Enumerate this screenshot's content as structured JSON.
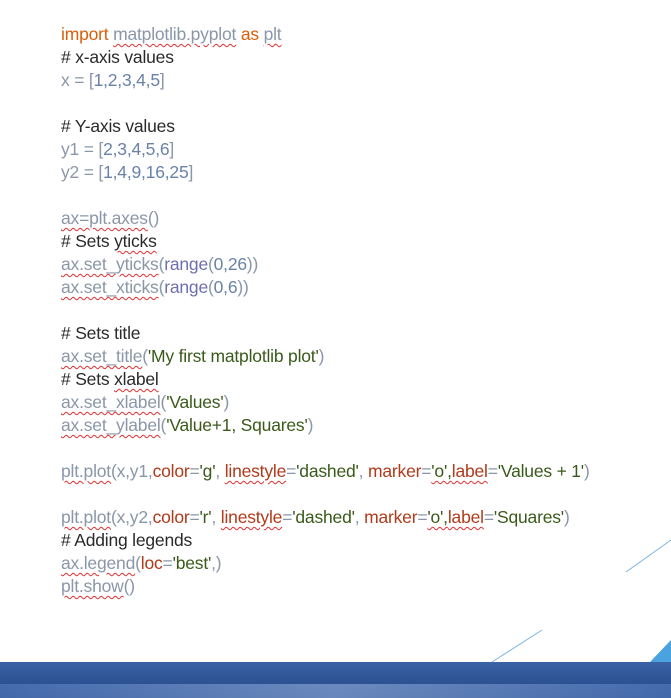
{
  "colors": {
    "keyword": "#d9600a",
    "module": "#8a97a8",
    "comment": "#2a2a2a",
    "plain": "#8a97a8",
    "number": "#6a82a8",
    "builtin": "#6f6fb0",
    "param": "#b03a1a",
    "string": "#3a5a1a"
  },
  "code_lines": [
    [
      {
        "t": "import",
        "c": "keyword"
      },
      {
        "t": " ",
        "c": "plain"
      },
      {
        "t": "matplotlib.pyplot",
        "c": "module",
        "sq": true
      },
      {
        "t": " as ",
        "c": "keyword"
      },
      {
        "t": "plt",
        "c": "module",
        "sq": true
      }
    ],
    [
      {
        "t": "# x-axis values",
        "c": "comment"
      }
    ],
    [
      {
        "t": "x = [",
        "c": "plain"
      },
      {
        "t": "1,2,3,4,5",
        "c": "number"
      },
      {
        "t": "]",
        "c": "plain"
      }
    ],
    [],
    [
      {
        "t": "# Y-axis values",
        "c": "comment"
      }
    ],
    [
      {
        "t": "y1 = [",
        "c": "plain"
      },
      {
        "t": "2,3,4,5,6",
        "c": "number"
      },
      {
        "t": "]",
        "c": "plain"
      }
    ],
    [
      {
        "t": "y2 = [",
        "c": "plain"
      },
      {
        "t": "1,4,9,16,25",
        "c": "number"
      },
      {
        "t": "]",
        "c": "plain"
      }
    ],
    [],
    [
      {
        "t": "ax=plt.axes",
        "c": "plain",
        "sq": true
      },
      {
        "t": "()",
        "c": "plain"
      }
    ],
    [
      {
        "t": "# Sets ",
        "c": "comment"
      },
      {
        "t": "yticks",
        "c": "comment",
        "sq": true
      }
    ],
    [
      {
        "t": "ax.set_yticks",
        "c": "plain",
        "sq": true
      },
      {
        "t": "(",
        "c": "plain"
      },
      {
        "t": "range",
        "c": "builtin"
      },
      {
        "t": "(",
        "c": "plain"
      },
      {
        "t": "0,26",
        "c": "number"
      },
      {
        "t": "))",
        "c": "plain"
      }
    ],
    [
      {
        "t": "ax.set_xticks",
        "c": "plain",
        "sq": true
      },
      {
        "t": "(",
        "c": "plain"
      },
      {
        "t": "range",
        "c": "builtin"
      },
      {
        "t": "(",
        "c": "plain"
      },
      {
        "t": "0,6",
        "c": "number"
      },
      {
        "t": "))",
        "c": "plain"
      }
    ],
    [],
    [
      {
        "t": "# Sets title",
        "c": "comment"
      }
    ],
    [
      {
        "t": "ax.set_title",
        "c": "plain",
        "sq": true
      },
      {
        "t": "(",
        "c": "plain"
      },
      {
        "t": "'My first matplotlib plot'",
        "c": "string"
      },
      {
        "t": ")",
        "c": "plain"
      }
    ],
    [
      {
        "t": "# Sets ",
        "c": "comment"
      },
      {
        "t": "xlabel",
        "c": "comment",
        "sq": true
      }
    ],
    [
      {
        "t": "ax.set_xlabel",
        "c": "plain",
        "sq": true
      },
      {
        "t": "(",
        "c": "plain"
      },
      {
        "t": "'Values'",
        "c": "string"
      },
      {
        "t": ")",
        "c": "plain"
      }
    ],
    [
      {
        "t": "ax.set_ylabel",
        "c": "plain",
        "sq": true
      },
      {
        "t": "(",
        "c": "plain"
      },
      {
        "t": "'Value+1, Squares'",
        "c": "string"
      },
      {
        "t": ")",
        "c": "plain"
      }
    ],
    [],
    [
      {
        "t": "plt.plot",
        "c": "plain",
        "sq": true
      },
      {
        "t": "(x,y1,",
        "c": "plain"
      },
      {
        "t": "color",
        "c": "param"
      },
      {
        "t": "=",
        "c": "plain"
      },
      {
        "t": "'g'",
        "c": "string"
      },
      {
        "t": ", ",
        "c": "plain"
      },
      {
        "t": "linestyle",
        "c": "param",
        "sq": true
      },
      {
        "t": "=",
        "c": "plain"
      },
      {
        "t": "'dashed'",
        "c": "string"
      },
      {
        "t": ", ",
        "c": "plain"
      },
      {
        "t": "marker",
        "c": "param"
      },
      {
        "t": "=",
        "c": "plain"
      },
      {
        "t": "'o',",
        "c": "string",
        "sq": true
      },
      {
        "t": "label",
        "c": "param",
        "sq": true
      },
      {
        "t": "=",
        "c": "plain"
      },
      {
        "t": "'Values + 1'",
        "c": "string"
      },
      {
        "t": ")",
        "c": "plain"
      }
    ],
    [],
    [
      {
        "t": "plt.plot",
        "c": "plain",
        "sq": true
      },
      {
        "t": "(x,y2,",
        "c": "plain"
      },
      {
        "t": "color",
        "c": "param"
      },
      {
        "t": "=",
        "c": "plain"
      },
      {
        "t": "'r'",
        "c": "string"
      },
      {
        "t": ", ",
        "c": "plain"
      },
      {
        "t": "linestyle",
        "c": "param",
        "sq": true
      },
      {
        "t": "=",
        "c": "plain"
      },
      {
        "t": "'dashed'",
        "c": "string"
      },
      {
        "t": ", ",
        "c": "plain"
      },
      {
        "t": "marker",
        "c": "param"
      },
      {
        "t": "=",
        "c": "plain"
      },
      {
        "t": "'o',",
        "c": "string",
        "sq": true
      },
      {
        "t": "label",
        "c": "param",
        "sq": true
      },
      {
        "t": "=",
        "c": "plain"
      },
      {
        "t": "'Squares'",
        "c": "string"
      },
      {
        "t": ")",
        "c": "plain"
      }
    ],
    [
      {
        "t": "# Adding legends",
        "c": "comment"
      }
    ],
    [
      {
        "t": "ax.legend",
        "c": "plain",
        "sq": true
      },
      {
        "t": "(",
        "c": "plain"
      },
      {
        "t": "loc",
        "c": "param"
      },
      {
        "t": "=",
        "c": "plain"
      },
      {
        "t": "'best'",
        "c": "string"
      },
      {
        "t": ",)",
        "c": "plain"
      }
    ],
    [
      {
        "t": "plt.show",
        "c": "plain",
        "sq": true
      },
      {
        "t": "()",
        "c": "plain"
      }
    ]
  ]
}
